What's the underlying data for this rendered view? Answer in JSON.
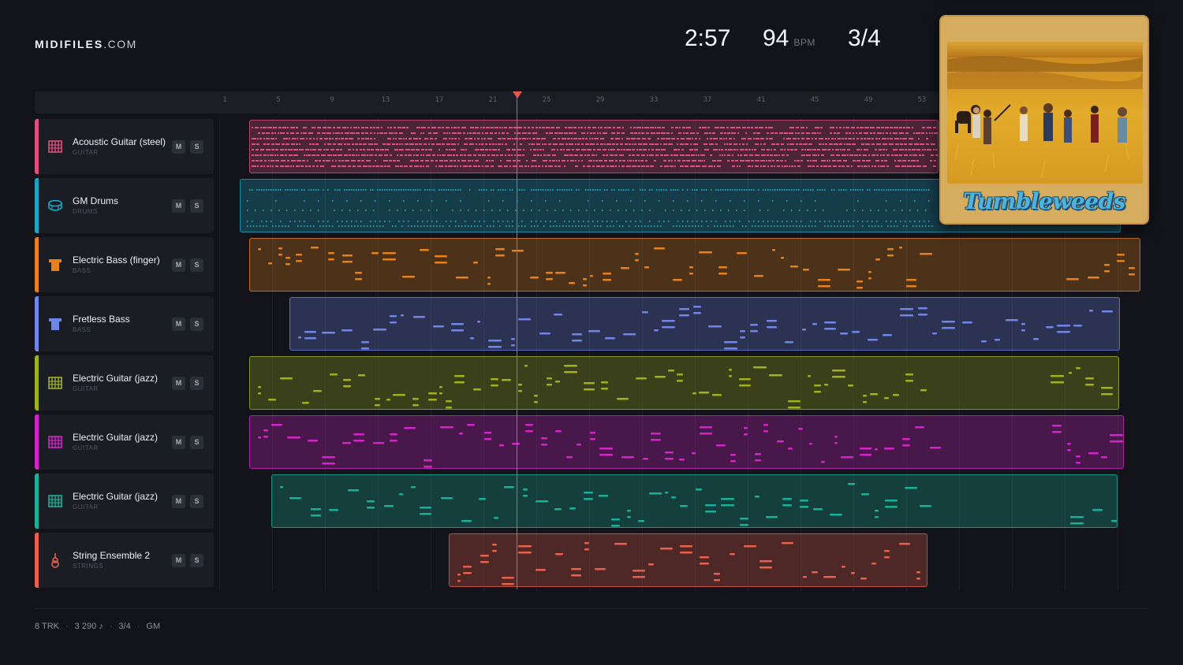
{
  "header": {
    "brand": "MIDIFILES",
    "tld": ".COM",
    "duration": "2:57",
    "bpm": "94",
    "bpm_unit": "BPM",
    "time_signature": "3/4"
  },
  "ruler": {
    "bars": [
      "1",
      "5",
      "9",
      "13",
      "17",
      "21",
      "25",
      "29",
      "33",
      "37",
      "41",
      "45",
      "49",
      "53"
    ]
  },
  "tracks": [
    {
      "name": "Acoustic Guitar (steel)",
      "category": "GUITAR",
      "color": "#e0507f",
      "icon": "guitar-grid-icon",
      "mute": "M",
      "solo": "S"
    },
    {
      "name": "GM Drums",
      "category": "DRUMS",
      "color": "#1ba5c4",
      "icon": "drum-icon",
      "mute": "M",
      "solo": "S"
    },
    {
      "name": "Electric Bass (finger)",
      "category": "BASS",
      "color": "#e7801d",
      "icon": "bass-icon",
      "mute": "M",
      "solo": "S"
    },
    {
      "name": "Fretless Bass",
      "category": "BASS",
      "color": "#6f86e6",
      "icon": "bass-icon",
      "mute": "M",
      "solo": "S"
    },
    {
      "name": "Electric Guitar (jazz)",
      "category": "GUITAR",
      "color": "#9fb21c",
      "icon": "guitar-grid-icon",
      "mute": "M",
      "solo": "S"
    },
    {
      "name": "Electric Guitar (jazz)",
      "category": "GUITAR",
      "color": "#d323c9",
      "icon": "guitar-grid-icon",
      "mute": "M",
      "solo": "S"
    },
    {
      "name": "Electric Guitar (jazz)",
      "category": "GUITAR",
      "color": "#19b09a",
      "icon": "guitar-grid-icon",
      "mute": "M",
      "solo": "S"
    },
    {
      "name": "String Ensemble 2",
      "category": "STRINGS",
      "color": "#e85f4c",
      "icon": "violin-icon",
      "mute": "M",
      "solo": "S"
    }
  ],
  "album": {
    "title": "Tumbleweeds"
  },
  "footer": {
    "tracks": "8 TRK",
    "notes": "3 290 ♪",
    "meter": "3/4",
    "standard": "GM"
  }
}
